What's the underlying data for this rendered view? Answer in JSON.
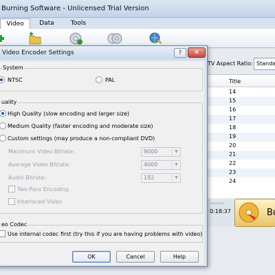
{
  "app": {
    "title": "Burning Software - Unlicensed Trial Version"
  },
  "main_tabs": [
    {
      "label": "Video"
    },
    {
      "label": "Data"
    },
    {
      "label": "Tools"
    }
  ],
  "toolbar": {
    "icons": [
      "add-file-icon",
      "add-folder-icon",
      "disc-icon",
      "disc-copy-icon",
      "globe-magnifier-icon"
    ]
  },
  "aspect": {
    "label": "TV Aspect Ratio:",
    "value": "Standa"
  },
  "title_list": {
    "header": "Title",
    "rows": [
      "14",
      "15",
      "16",
      "17",
      "18",
      "19",
      "20",
      "21",
      "22",
      "23",
      "24"
    ]
  },
  "status": {
    "time_top": "--:--:--",
    "time_bottom": "0:18:37"
  },
  "burn_button": {
    "label": "Bu"
  },
  "dialog": {
    "title": "Video Encoder Settings",
    "help_btn": "?",
    "close_btn": "✕",
    "system": {
      "label": "System",
      "ntsc": "NTSC",
      "pal": "PAL",
      "selected": "NTSC"
    },
    "quality": {
      "label": "uality",
      "options": [
        "High Quality (slow encoding and larger size)",
        "Medium Quality (faster encoding and moderate size)",
        "Custom settings (may produce a non-compliant DVD)"
      ],
      "selected": 0,
      "max_bitrate": {
        "label": "Maximum Video Bitrate:",
        "value": "9000"
      },
      "avg_bitrate": {
        "label": "Average Video Bitrate:",
        "value": "4000"
      },
      "audio_bitrate": {
        "label": "Audio Bitrate:",
        "value": "192"
      },
      "two_pass": "Two Pass Encoding",
      "interlaced": "Interlaced Video"
    },
    "codec": {
      "label": "eo Codec",
      "internal_first": "Use internal codec first (try this if you are having problems with video)"
    },
    "buttons": {
      "ok": "OK",
      "cancel": "Cancel",
      "help": "Help"
    }
  }
}
